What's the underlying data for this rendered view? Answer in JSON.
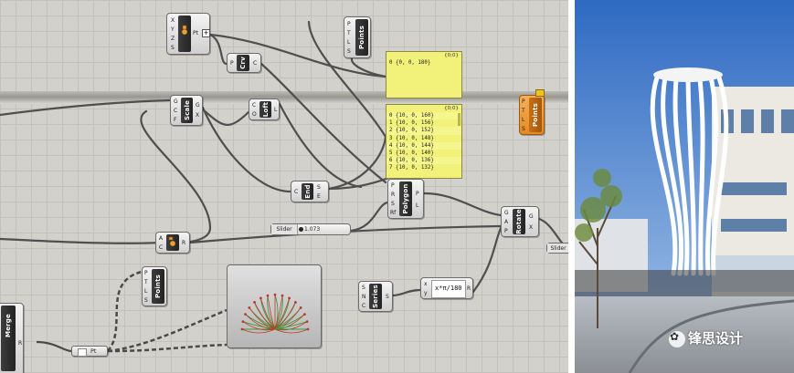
{
  "nodes": {
    "pt_top": {
      "inputs": [
        "X",
        "Y",
        "Z",
        "S"
      ],
      "name": "Pt"
    },
    "points_top": {
      "inputs": [
        "P",
        "T",
        "L",
        "S"
      ],
      "name": "Points"
    },
    "crv": {
      "input": "P",
      "name": "Crv",
      "output": "C"
    },
    "scale": {
      "inputs": [
        "G",
        "C",
        "F"
      ],
      "name": "Scale",
      "outputs": [
        "G",
        "X"
      ]
    },
    "loft": {
      "inputs": [
        "C",
        "O"
      ],
      "name": "Loft",
      "output": "L"
    },
    "end": {
      "input": "C",
      "name": "End",
      "outputs": [
        "S",
        "E"
      ]
    },
    "polygon": {
      "inputs": [
        "P",
        "R",
        "S",
        "Rf"
      ],
      "name": "Polygon",
      "outputs": [
        "P",
        "L"
      ]
    },
    "rotate": {
      "inputs": [
        "G",
        "A",
        "P"
      ],
      "name": "Rotate",
      "outputs": [
        "G",
        "X"
      ]
    },
    "points_orange": {
      "inputs": [
        "P",
        "T",
        "L",
        "S"
      ],
      "name": "Points"
    },
    "points_mid": {
      "inputs": [
        "P",
        "T",
        "L",
        "S"
      ],
      "name": "Points"
    },
    "series": {
      "inputs": [
        "S",
        "N",
        "C"
      ],
      "name": "Series",
      "output": "S"
    },
    "expression": {
      "inputs": [
        "x",
        "y"
      ],
      "text": "x*π/180",
      "output": "R"
    },
    "anchor": {
      "inputs": [
        "A",
        "C"
      ],
      "output": "R"
    },
    "merge": {
      "name": "Merge",
      "output": "R"
    },
    "pt_bottom": {
      "name": "Pt"
    }
  },
  "panel_small": {
    "header": "{0;0}",
    "rows": [
      "0 {0, 0, 180}"
    ]
  },
  "panel_large": {
    "header": "{0;0}",
    "rows": [
      "0 {10, 0, 160}",
      "1 {10, 0, 156}",
      "2 {10, 0, 152}",
      "3 {10, 0, 148}",
      "4 {10, 0, 144}",
      "5 {10, 0, 140}",
      "6 {10, 0, 136}",
      "7 {10, 0, 132}"
    ]
  },
  "slider_main": {
    "name": "Slider",
    "value": "1.073"
  },
  "slider_edge": {
    "name": "Slider"
  },
  "watermark": {
    "text": "锋思设计"
  },
  "colors": {
    "canvas": "#d3d1cb",
    "panel": "#f2f27a",
    "component_dark": "#2f2f2f",
    "points_orange": "#e8922b",
    "wire": "#555555",
    "preview_green": "#3a9a3a",
    "preview_red": "#c0392b"
  }
}
